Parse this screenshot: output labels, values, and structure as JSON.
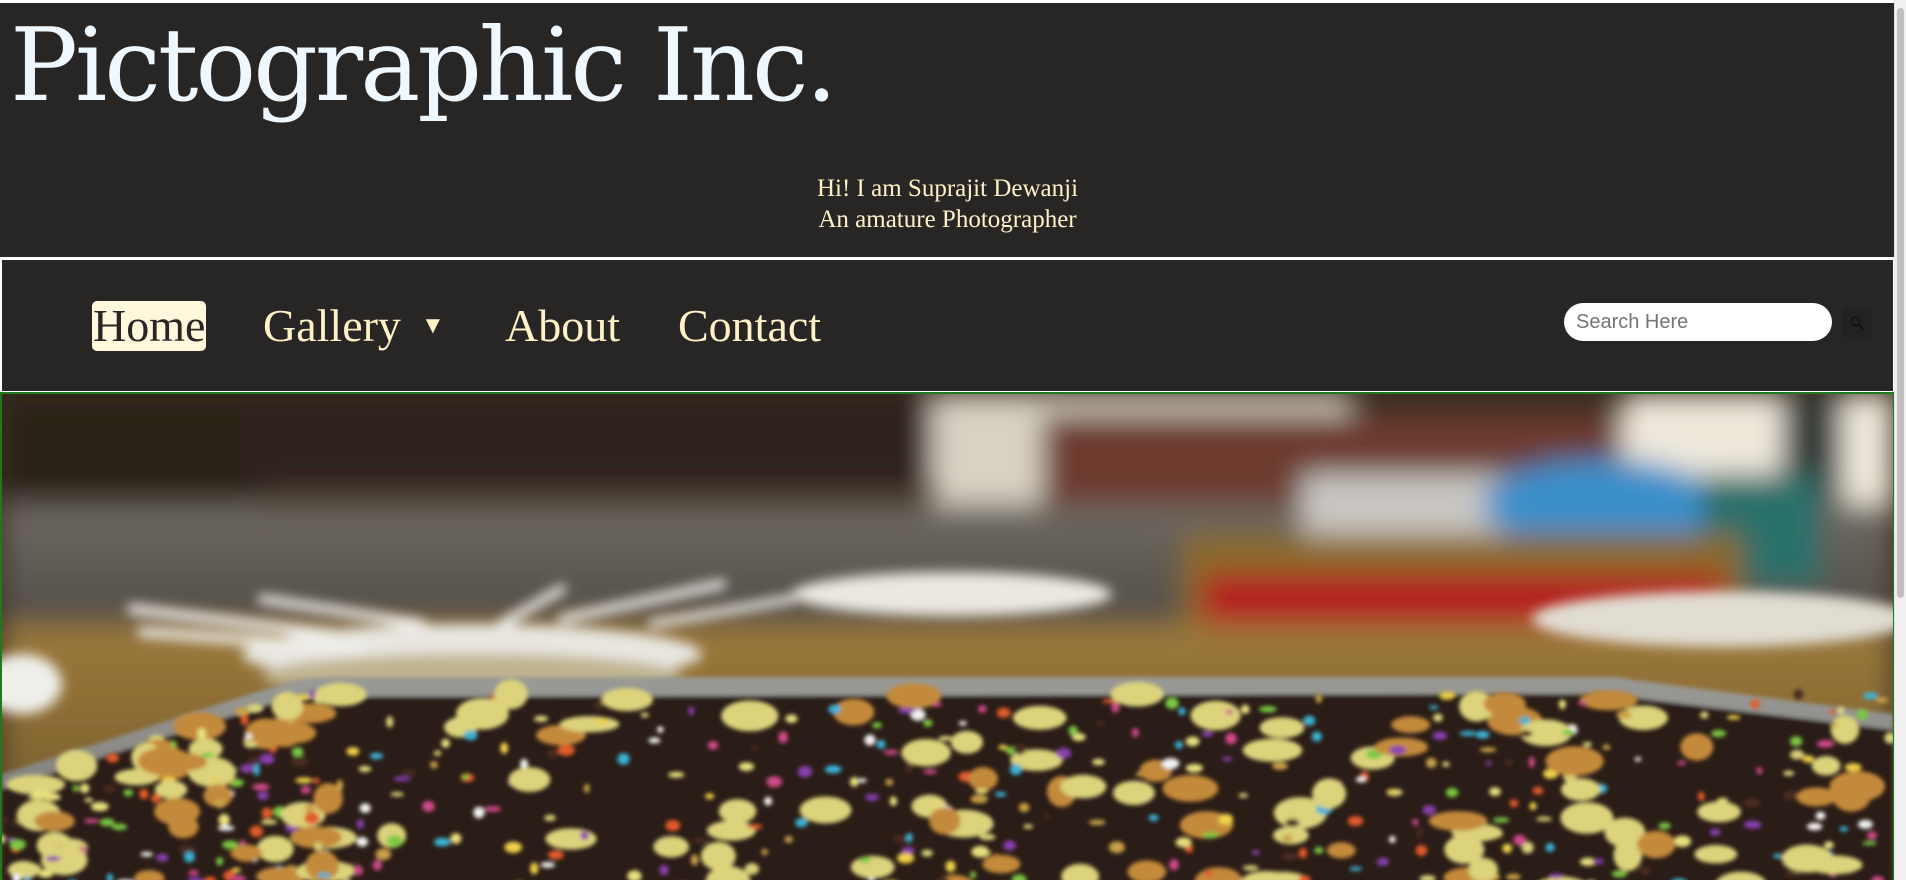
{
  "header": {
    "site_title": "Pictographic Inc.",
    "tagline_line1": "Hi! I am Suprajit Dewanji",
    "tagline_line2": "An amature Photographer"
  },
  "nav": {
    "items": [
      {
        "label": "Home",
        "active": true
      },
      {
        "label": "Gallery",
        "has_dropdown": true
      },
      {
        "label": "About"
      },
      {
        "label": "Contact"
      }
    ],
    "gallery_caret": "▼",
    "search": {
      "placeholder": "Search Here",
      "value": "",
      "button_icon": "search-icon"
    }
  },
  "colors": {
    "header_bg": "#272625",
    "title_text": "#f0f8ff",
    "nav_text": "#fff1c8",
    "active_bg": "#fff8dc",
    "hero_border": "#1f7a1f"
  }
}
